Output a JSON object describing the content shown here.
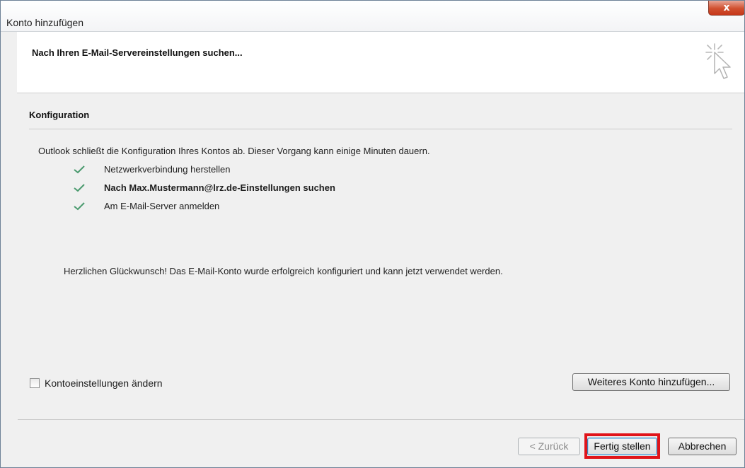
{
  "window": {
    "title": "Konto hinzufügen",
    "close_label": "x"
  },
  "header": {
    "title": "Nach Ihren E-Mail-Servereinstellungen suchen...",
    "icon": "cursor-click-icon"
  },
  "config": {
    "heading": "Konfiguration",
    "intro": "Outlook schließt die Konfiguration Ihres Kontos ab. Dieser Vorgang kann einige Minuten dauern.",
    "steps": [
      {
        "label": "Netzwerkverbindung herstellen",
        "status": "done",
        "bold": false
      },
      {
        "label": "Nach Max.Mustermann@lrz.de-Einstellungen suchen",
        "status": "done",
        "bold": true
      },
      {
        "label": "Am E-Mail-Server anmelden",
        "status": "done",
        "bold": false
      }
    ],
    "success": "Herzlichen Glückwunsch! Das E-Mail-Konto wurde erfolgreich konfiguriert und kann jetzt verwendet werden."
  },
  "options": {
    "change_settings_label": "Kontoeinstellungen ändern",
    "change_settings_checked": false,
    "add_account_button": "Weiteres Konto hinzufügen..."
  },
  "footer": {
    "back_button": "< Zurück",
    "finish_button": "Fertig stellen",
    "cancel_button": "Abbrechen"
  },
  "colors": {
    "check": "#4a9a6e",
    "highlight": "#e0141a",
    "close": "#c7381b"
  }
}
